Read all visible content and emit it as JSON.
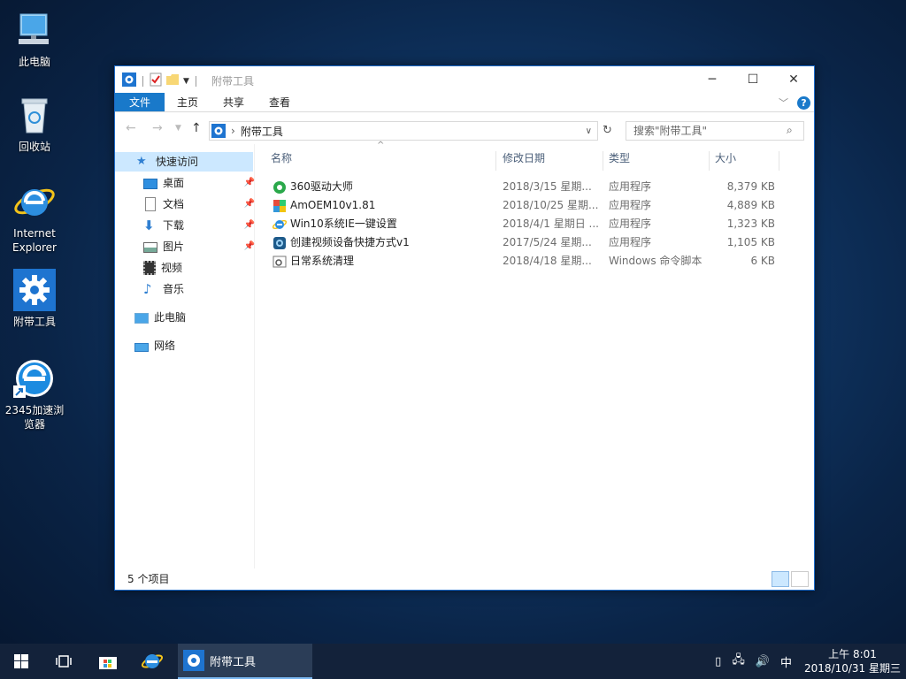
{
  "desktop": {
    "icons": [
      {
        "label": "此电脑"
      },
      {
        "label": "回收站"
      },
      {
        "label": "Internet Explorer"
      },
      {
        "label": "附带工具"
      },
      {
        "label": "2345加速浏览器"
      }
    ]
  },
  "window": {
    "title": "附带工具",
    "ribbon_tabs": [
      "文件",
      "主页",
      "共享",
      "查看"
    ],
    "help_label": "?",
    "address_path": "附带工具",
    "search_placeholder": "搜索\"附带工具\"",
    "nav": {
      "quick_access": "快速访问",
      "items": [
        "桌面",
        "文档",
        "下载",
        "图片",
        "视频",
        "音乐"
      ],
      "this_pc": "此电脑",
      "network": "网络"
    },
    "columns": [
      "名称",
      "修改日期",
      "类型",
      "大小"
    ],
    "files": [
      {
        "name": "360驱动大师",
        "date": "2018/3/15 星期...",
        "type": "应用程序",
        "size": "8,379 KB"
      },
      {
        "name": "AmOEM10v1.81",
        "date": "2018/10/25 星期...",
        "type": "应用程序",
        "size": "4,889 KB"
      },
      {
        "name": "Win10系统IE一键设置",
        "date": "2018/4/1 星期日 ...",
        "type": "应用程序",
        "size": "1,323 KB"
      },
      {
        "name": "创建视频设备快捷方式v1",
        "date": "2017/5/24 星期...",
        "type": "应用程序",
        "size": "1,105 KB"
      },
      {
        "name": "日常系统清理",
        "date": "2018/4/18 星期...",
        "type": "Windows 命令脚本",
        "size": "6 KB"
      }
    ],
    "status_text": "5 个项目"
  },
  "taskbar": {
    "active_app": "附带工具",
    "ime": "中",
    "time": "上午 8:01",
    "date": "2018/10/31 星期三"
  },
  "colors": {
    "accent": "#1979ca",
    "taskbar": "#13223a",
    "selection": "#cce8ff"
  }
}
